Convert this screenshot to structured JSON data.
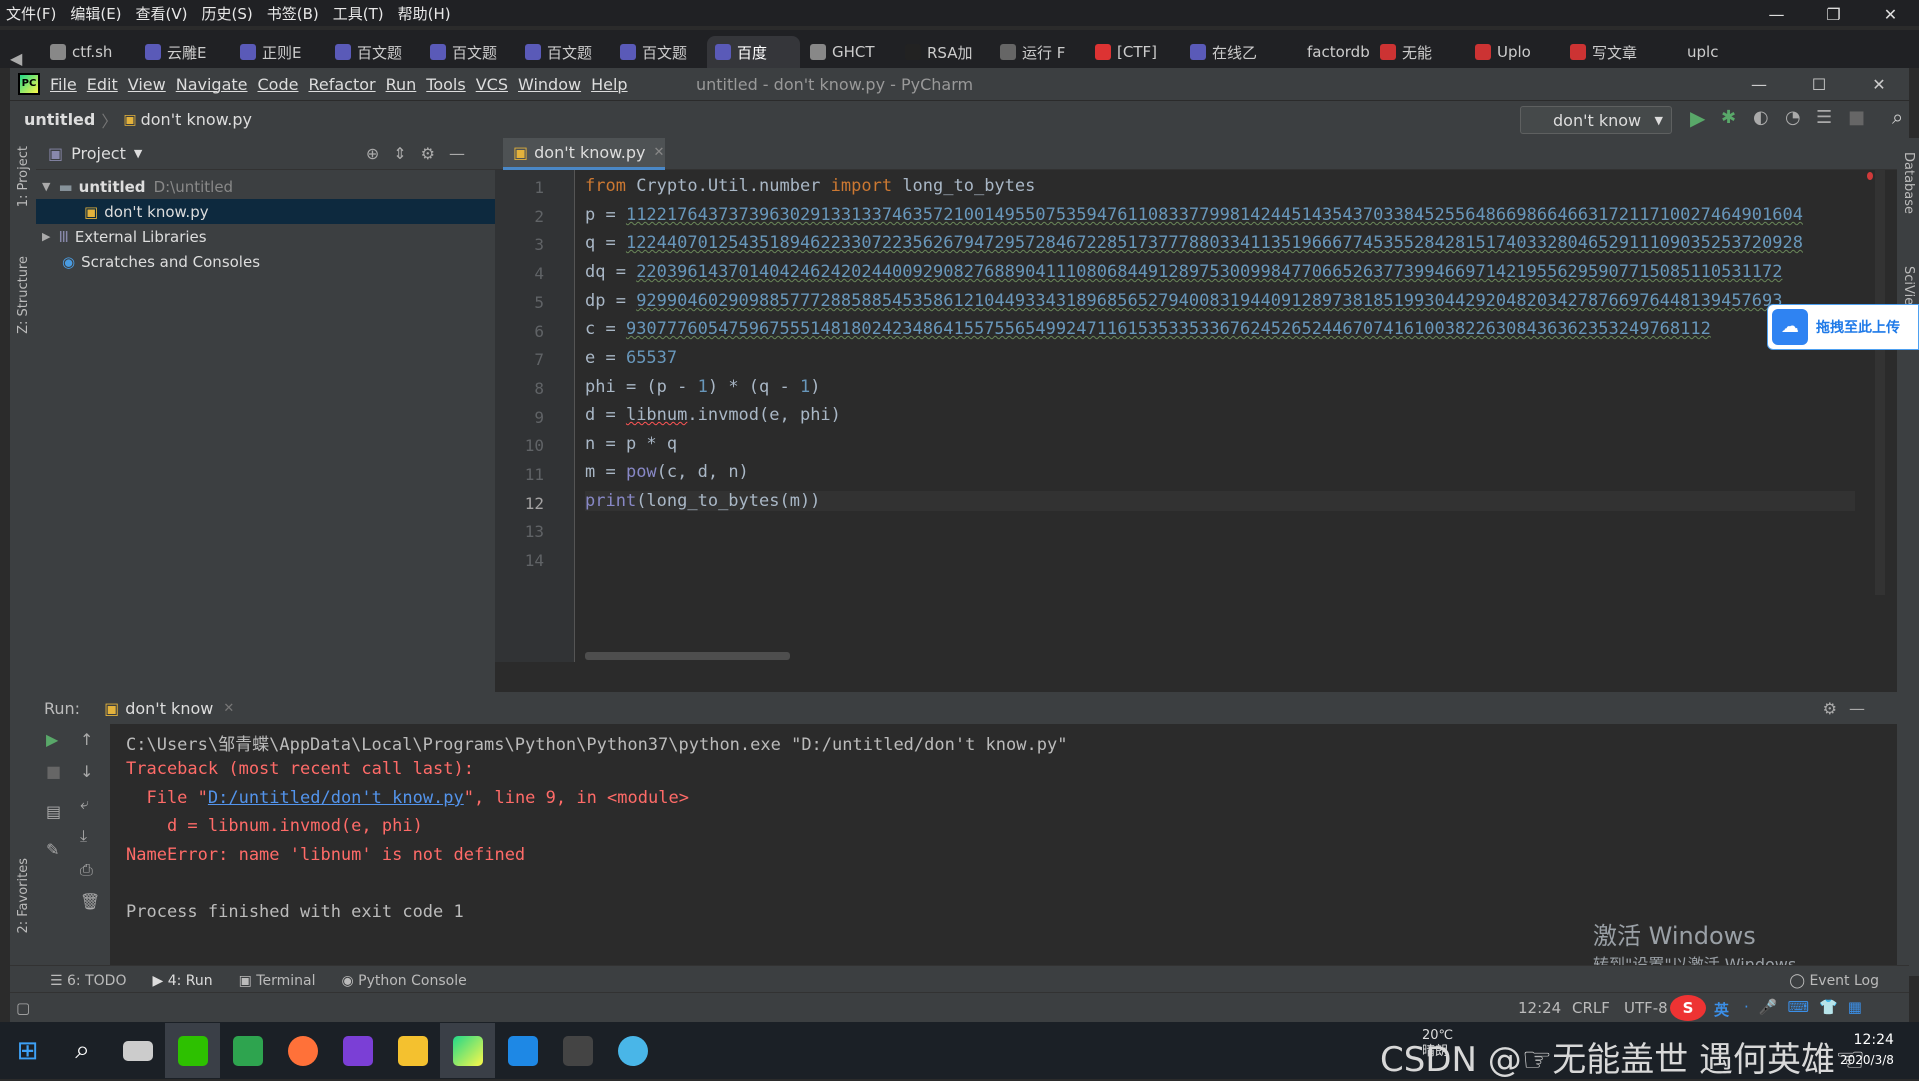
{
  "browser": {
    "menu": [
      "文件(F)",
      "编辑(E)",
      "查看(V)",
      "历史(S)",
      "书签(B)",
      "工具(T)",
      "帮助(H)"
    ],
    "window_controls": [
      "—",
      "❐",
      "✕"
    ],
    "tabs": [
      {
        "label": "ctf.sh",
        "color": "#888"
      },
      {
        "label": "云雕E",
        "color": "#5a5ab8"
      },
      {
        "label": "正则E",
        "color": "#5a5ab8"
      },
      {
        "label": "百文题",
        "color": "#5a5ab8"
      },
      {
        "label": "百文题",
        "color": "#5a5ab8"
      },
      {
        "label": "百文题",
        "color": "#5a5ab8"
      },
      {
        "label": "百文题",
        "color": "#5a5ab8"
      },
      {
        "label": "百度",
        "color": "#5a5ab8",
        "active": true
      },
      {
        "label": "GHCT",
        "color": "#888"
      },
      {
        "label": "RSA加",
        "color": "#222"
      },
      {
        "label": "运行 F",
        "color": "#666"
      },
      {
        "label": "[CTF]",
        "color": "#d33"
      },
      {
        "label": "在线乙",
        "color": "#5a5ab8"
      },
      {
        "label": "factordb.",
        "color": "#202124"
      },
      {
        "label": "无能",
        "color": "#c33"
      },
      {
        "label": "Uplo",
        "color": "#c33"
      },
      {
        "label": "写文章",
        "color": "#c33"
      },
      {
        "label": "uplc",
        "color": "#202124"
      }
    ]
  },
  "ide": {
    "menu": [
      "File",
      "Edit",
      "View",
      "Navigate",
      "Code",
      "Refactor",
      "Run",
      "Tools",
      "VCS",
      "Window",
      "Help"
    ],
    "title": "untitled - don't know.py - PyCharm",
    "breadcrumb": {
      "project": "untitled",
      "file": "don't know.py"
    },
    "run_config": "don't know",
    "project_panel": {
      "title": "Project",
      "root": "untitled",
      "root_path": "D:\\untitled",
      "file": "don't know.py",
      "ext_libs": "External Libraries",
      "scratches": "Scratches and Consoles"
    },
    "side_labels": {
      "project": "1: Project",
      "structure": "Z: Structure",
      "favorites": "2: Favorites",
      "database": "Database",
      "sciview": "SciView"
    },
    "editor_tab": "don't know.py",
    "code": {
      "l1": {
        "k1": "from",
        "mod": " Crypto.Util.number ",
        "k2": "import",
        "name": " long_to_bytes"
      },
      "p": {
        "pre": "p = ",
        "val": "1122176437373963029133133746357210014955075359476110833779981424451435437033845255648669866466317211710027464901604"
      },
      "q": {
        "pre": "q = ",
        "val": "1224407012543518946223307223562679472957284672285173777880334113519666774535528428151740332804652911109035253720928"
      },
      "dq": {
        "pre": "dq = ",
        "val": "2203961437014042462420244009290827688904111080684491289753009984770665263773994669714219556295907715085110531172"
      },
      "dp": {
        "pre": "dp = ",
        "val": "9299046029098857772885885453586121044933431896856527940083194409128973818519930442920482034278766976448139457693"
      },
      "c": {
        "pre": "c = ",
        "val": "9307776054759675551481802423486415575565499247116153533533676245265244670741610038226308436362353249768112"
      },
      "e": {
        "pre": "e = ",
        "val": "65537"
      },
      "phi": {
        "a": "phi = (p - ",
        "n1": "1",
        "b": ") * (q - ",
        "n2": "1",
        "c": ")"
      },
      "d": {
        "a": "d = ",
        "lib": "libnum",
        "b": ".invmod(e, phi)"
      },
      "n": "n = p * q",
      "m": {
        "a": "m = ",
        "fn": "pow",
        "b": "(c, d, n)"
      },
      "print": {
        "fn": "print",
        "a": "(long_to_bytes(m))"
      }
    },
    "line_numbers": [
      "1",
      "2",
      "3",
      "4",
      "5",
      "6",
      "7",
      "8",
      "9",
      "10",
      "11",
      "12",
      "13",
      "14"
    ],
    "run": {
      "label": "Run:",
      "tab": "don't know",
      "cmd": "C:\\Users\\邹青蝶\\AppData\\Local\\Programs\\Python\\Python37\\python.exe \"D:/untitled/don't know.py\"",
      "tb1": "Traceback (most recent call last):",
      "file_pre": "  File \"",
      "file_link": "D:/untitled/don't know.py",
      "file_post": "\", line 9, in <module>",
      "tb_code": "    d = libnum.invmod(e, phi)",
      "tb_err": "NameError: name 'libnum' is not defined",
      "finished": "Process finished with exit code 1"
    },
    "bottom_tabs": {
      "todo": "6: TODO",
      "run": "4: Run",
      "terminal": "Terminal",
      "console": "Python Console",
      "event_log": "Event Log"
    },
    "status": {
      "pos": "12:24",
      "crlf": "CRLF",
      "enc": "UTF-8"
    }
  },
  "overlay": {
    "baidu": "拖拽至此上传",
    "activate1": "激活 Windows",
    "activate2": "转到\"设置\"以激活 Windows。",
    "watermark": "CSDN @☞无能盖世 遇何英雄☜"
  },
  "tray": {
    "temp": "20℃",
    "weather": "晴朗",
    "ime": "英",
    "time": "12:24",
    "date": "2020/3/8"
  }
}
